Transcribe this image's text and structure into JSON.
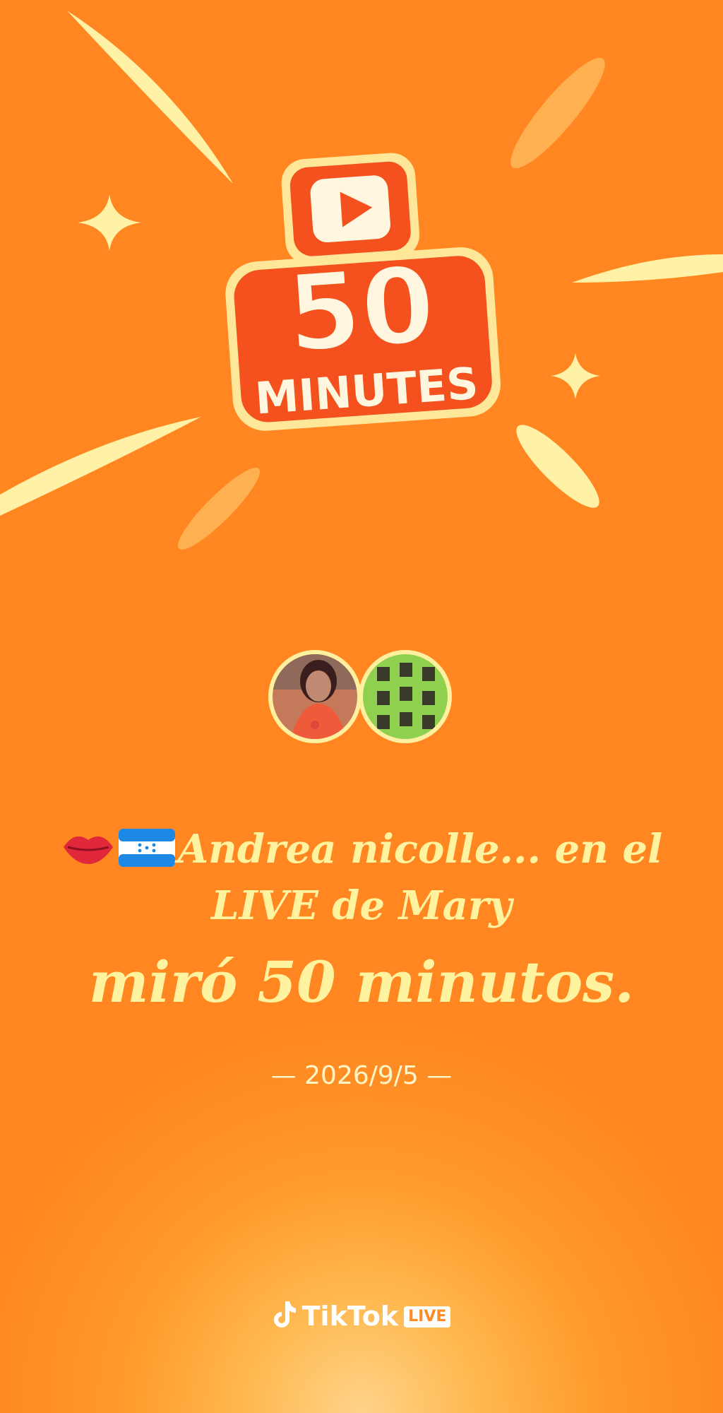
{
  "badge": {
    "number": "50",
    "word": "MINUTES",
    "icon": "play-icon"
  },
  "avatars": [
    {
      "name": "viewer-avatar",
      "icon": "person-photo"
    },
    {
      "name": "host-avatar",
      "icon": "grid-photo"
    }
  ],
  "message": {
    "emojis": [
      "kiss-mark-emoji",
      "honduras-flag-emoji"
    ],
    "line1": "Andrea nicolle... en el",
    "line2": "LIVE de Mary",
    "line3": "miró 50 minutos."
  },
  "date": "— 2026/9/5 —",
  "brand": {
    "name": "TikTok",
    "tag": "LIVE"
  },
  "colors": {
    "background": "#ff8620",
    "text": "#fff3a0",
    "badge_red": "#f4511e"
  }
}
